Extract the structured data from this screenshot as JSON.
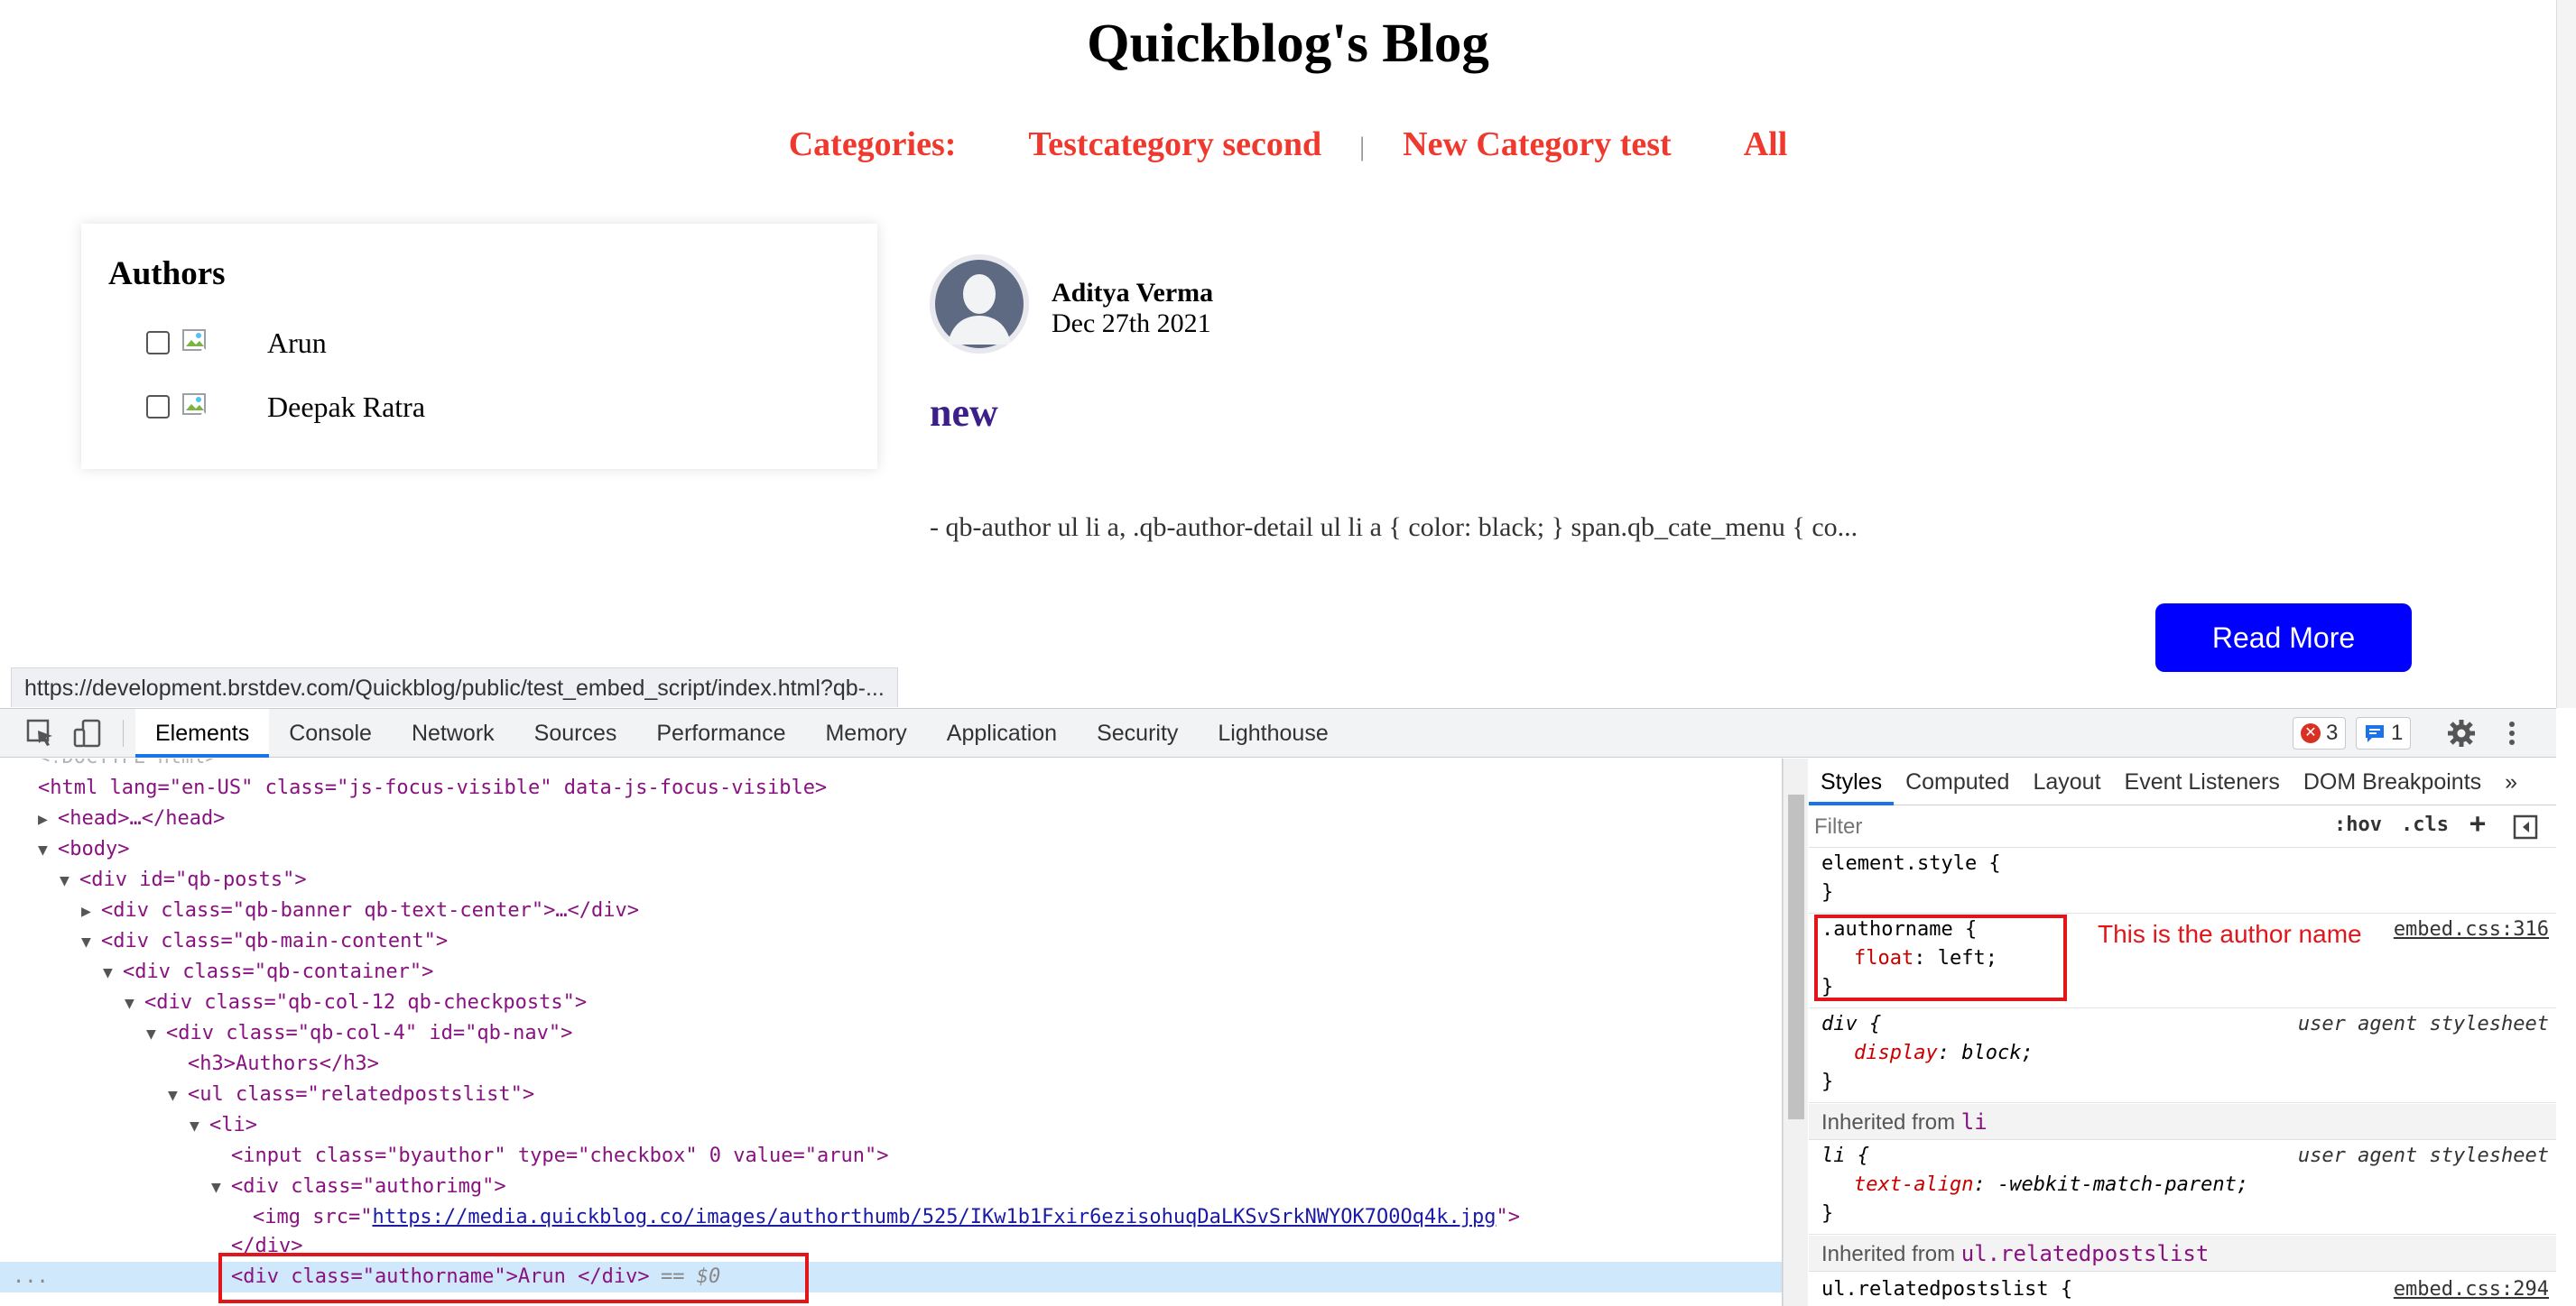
{
  "blog": {
    "title": "Quickblog's Blog",
    "categories_label": "Categories:",
    "categories": [
      "Testcategory second",
      "New Category test"
    ],
    "separator": "|",
    "all_label": "All",
    "authors_heading": "Authors",
    "authors": [
      "Arun",
      "Deepak Ratra"
    ],
    "post": {
      "author": "Aditya Verma",
      "date": "Dec 27th 2021",
      "title": "new",
      "excerpt": "- qb-author ul li a, .qb-author-detail ul li a { color: black; } span.qb_cate_menu { co...",
      "read_more": "Read More"
    },
    "status_url": "https://development.brstdev.com/Quickblog/public/test_embed_script/index.html?qb-..."
  },
  "devtools": {
    "tabs": [
      "Elements",
      "Console",
      "Network",
      "Sources",
      "Performance",
      "Memory",
      "Application",
      "Security",
      "Lighthouse"
    ],
    "active_tab": "Elements",
    "error_count": "3",
    "message_count": "1",
    "colors": {
      "accent": "#1a73e8",
      "error": "#d93025",
      "info": "#1a73e8",
      "annotation": "#e0161b"
    },
    "dom": {
      "doctype": "<!DOCTYPE html>",
      "html_open": "<html lang=\"en-US\" class=\"js-focus-visible\" data-js-focus-visible>",
      "head": "<head>…</head>",
      "body": "<body>",
      "qb_posts": "<div id=\"qb-posts\">",
      "banner": "<div class=\"qb-banner qb-text-center\">…</div>",
      "main_content": "<div class=\"qb-main-content\">",
      "container": "<div class=\"qb-container\">",
      "col12": "<div class=\"qb-col-12 qb-checkposts\">",
      "col4": "<div class=\"qb-col-4\" id=\"qb-nav\">",
      "h3": "<h3>Authors</h3>",
      "ul": "<ul class=\"relatedpostslist\">",
      "li": "<li>",
      "input": "<input class=\"byauthor\" type=\"checkbox\" 0 value=\"arun\">",
      "authorimg": "<div class=\"authorimg\">",
      "img_prefix": "<img src=\"",
      "img_url": "https://media.quickblog.co/images/authorthumb/525/IKw1b1Fxir6ezisohuqDaLKSvSrkNWYOK7O0Oq4k.jpg",
      "img_suffix": "\">",
      "div_close": "</div>",
      "selected": "<div class=\"authorname\">Arun </div>",
      "selected_suffix": "== $0",
      "gutter_dots": "..."
    },
    "styles": {
      "tabs": [
        "Styles",
        "Computed",
        "Layout",
        "Event Listeners",
        "DOM Breakpoints"
      ],
      "more": "»",
      "filter_placeholder": "Filter",
      "hov": ":hov",
      "cls": ".cls",
      "plus": "+",
      "element_style": "element.style {",
      "close_brace": "}",
      "rule1_selector": ".authorname {",
      "rule1_decl_name": "float",
      "rule1_decl_value": "left;",
      "rule1_source": "embed.css:316",
      "annotation": "This is the author  name",
      "rule2_selector": "div {",
      "rule2_decl_name": "display",
      "rule2_decl_value": "block;",
      "ua_source": "user agent stylesheet",
      "inherited_prefix": "Inherited from",
      "inherited_li": "li",
      "rule3_selector": "li {",
      "rule3_decl_name": "text-align",
      "rule3_decl_value": "-webkit-match-parent;",
      "inherited_ul": "ul.relatedpostslist",
      "rule4_selector": "ul.relatedpostslist {",
      "rule4_source": "embed.css:294"
    }
  }
}
